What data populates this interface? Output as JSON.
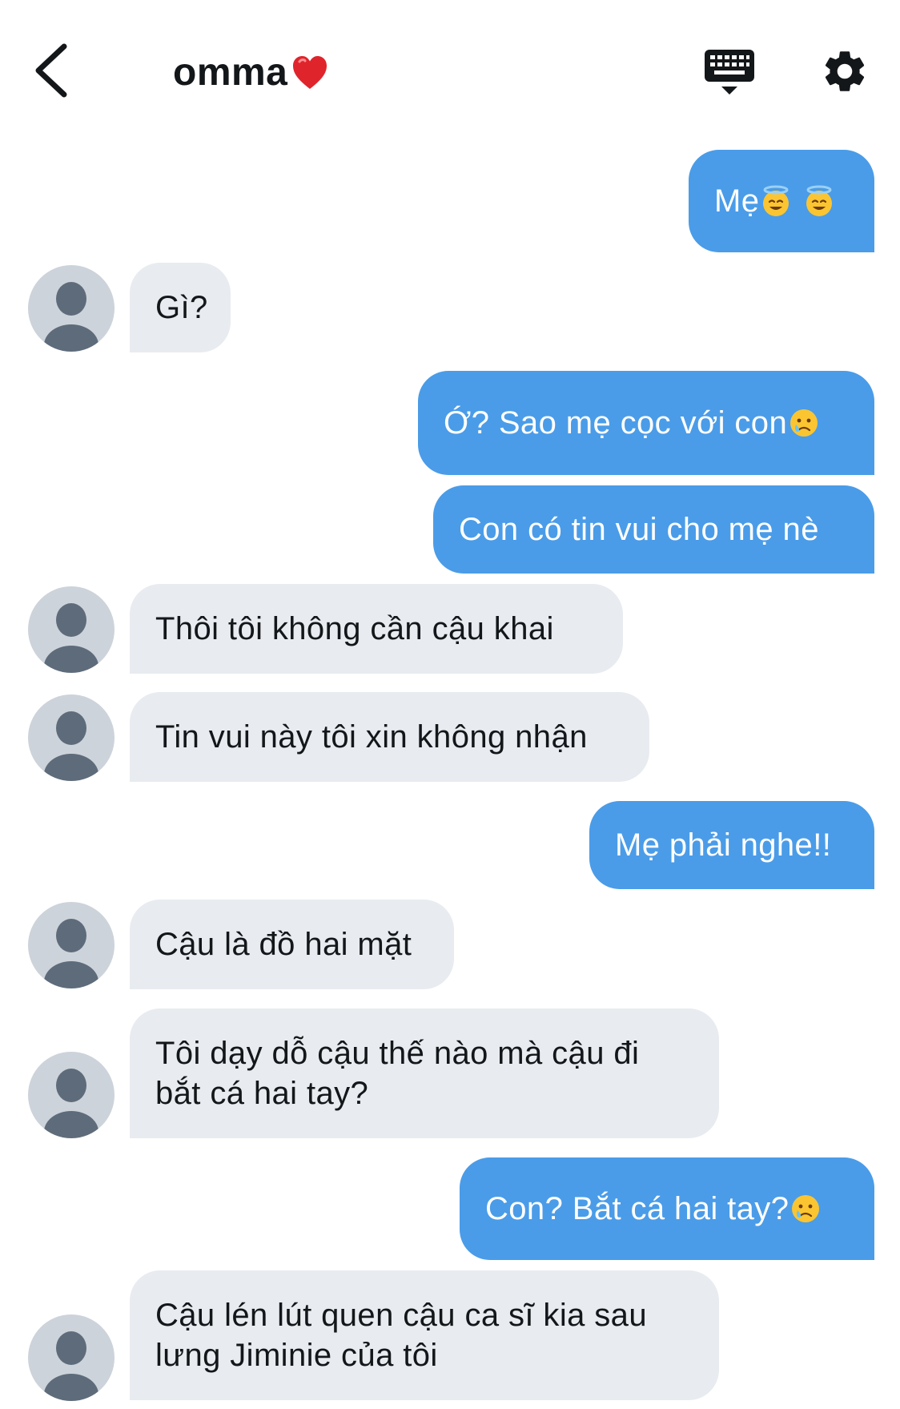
{
  "header": {
    "title": "omma",
    "back_icon": "chevron-left-icon",
    "keyboard_icon": "keyboard-icon",
    "settings_icon": "gear-icon"
  },
  "colors": {
    "outgoing_bubble": "#4a9ce8",
    "incoming_bubble": "#e8ebef",
    "avatar_bg": "#cdd3da",
    "avatar_fg": "#5e6b7a",
    "heart": "#e0242c"
  },
  "messages": [
    {
      "side": "out",
      "text": "Mẹ",
      "emoji": "smiling-face-with-halo"
    },
    {
      "side": "in",
      "text": "Gì?"
    },
    {
      "side": "out",
      "text": "Ớ? Sao mẹ cọc với con",
      "emoji": "crying-face"
    },
    {
      "side": "out",
      "text": "Con có tin vui cho mẹ nè"
    },
    {
      "side": "in",
      "text": "Thôi tôi không cần cậu khai"
    },
    {
      "side": "in",
      "text": "Tin vui này tôi xin không nhận"
    },
    {
      "side": "out",
      "text": "Mẹ phải nghe!!"
    },
    {
      "side": "in",
      "text": "Cậu là đồ hai mặt"
    },
    {
      "side": "in",
      "text": "Tôi dạy dỗ cậu thế nào mà cậu đi bắt cá hai tay?"
    },
    {
      "side": "out",
      "text": "Con? Bắt cá hai tay?",
      "emoji": "crying-face"
    },
    {
      "side": "in",
      "text": "Cậu lén lút quen cậu ca sĩ kia sau lưng Jiminie của tôi"
    }
  ]
}
